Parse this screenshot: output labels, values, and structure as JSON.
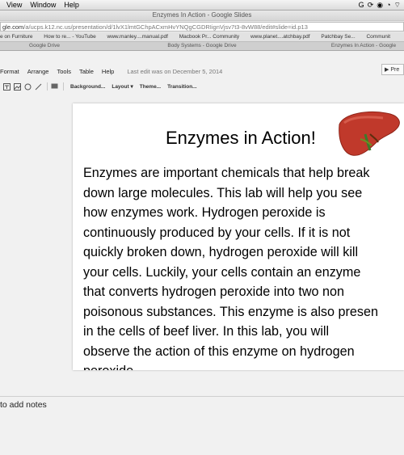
{
  "menubar": {
    "items": [
      "View",
      "Window",
      "Help"
    ]
  },
  "browser": {
    "window_title": "Enzymes In Action - Google Slides",
    "url_host": "gle.com",
    "url_path": "/a/ucps.k12.nc.us/presentation/d/1lvX1lmtGChpACxmHvYNQgCGDRIignVjsv7t3-8vW88/edit#slide=id.p13",
    "bookmarks": [
      "e on Furniture",
      "How to re... - YouTube",
      "www.manley....manual.pdf",
      "Macbook Pr... Community",
      "www.planet....atchbay.pdf",
      "Patchbay Se...",
      "Communit"
    ],
    "tabs": [
      "Google Drive",
      "Body Systems - Google Drive",
      "Enzymes In Action - Google"
    ]
  },
  "slides_app": {
    "menu": [
      "Format",
      "Arrange",
      "Tools",
      "Table",
      "Help"
    ],
    "last_edit": "Last edit was on December 5, 2014",
    "present_label": "Pre",
    "toolbar": {
      "background": "Background...",
      "layout": "Layout",
      "theme": "Theme...",
      "transition": "Transition..."
    }
  },
  "slide": {
    "title": "Enzymes in Action!",
    "body": "Enzymes are important chemicals that help break\ndown large molecules.  This lab will help you see\nhow enzymes work.  Hydrogen peroxide is\ncontinuously produced by your cells.  If it is not\nquickly broken down, hydrogen peroxide will kill\nyour cells.  Luckily, your cells contain an enzyme\nthat converts hydrogen peroxide into two non\npoisonous substances.  This enzyme is also presen\nin the cells of beef liver.  In this lab, you will\nobserve the action of this enzyme on hydrogen\nperoxide."
  },
  "notes": {
    "placeholder": "to add notes"
  }
}
